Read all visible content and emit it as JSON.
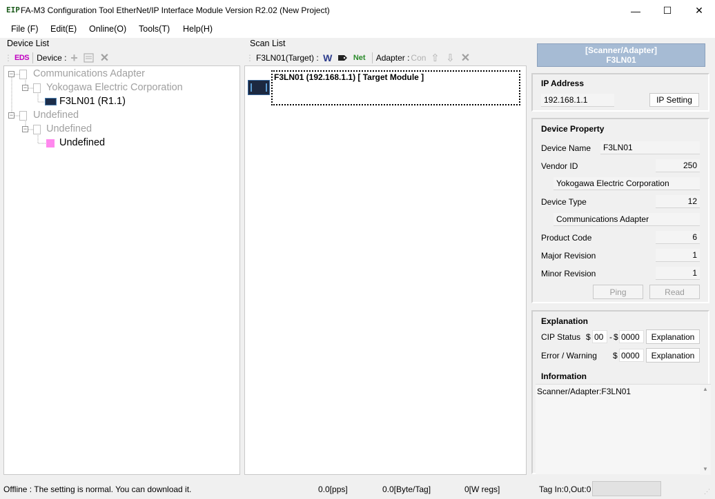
{
  "window": {
    "title": "FA-M3 Configuration Tool EtherNet/IP Interface Module Version R2.02 (New Project)",
    "app_icon": "EIP",
    "controls": {
      "minimize": "—",
      "maximize": "☐",
      "close": "✕"
    }
  },
  "menu": [
    "File (F)",
    "Edit(E)",
    "Online(O)",
    "Tools(T)",
    "Help(H)"
  ],
  "device_list": {
    "label": "Device List",
    "toolbar": {
      "eds": "EDS",
      "device_label": "Device :"
    },
    "tree": [
      {
        "label": "Communications Adapter"
      },
      {
        "label": "Yokogawa Electric Corporation"
      },
      {
        "label": "F3LN01  (R1.1)"
      },
      {
        "label": "Undefined"
      },
      {
        "label": "Undefined"
      },
      {
        "label": "Undefined"
      }
    ]
  },
  "scan_list": {
    "label": "Scan List",
    "toolbar": {
      "target_label": "F3LN01(Target) :",
      "adapter_label": "Adapter :",
      "con_label": "Con",
      "w_icon": "W",
      "net_icon": "Net"
    },
    "item": "F3LN01 (192.168.1.1)  [ Target Module ]"
  },
  "right_panel": {
    "header_line1": "[Scanner/Adapter]",
    "header_line2": "F3LN01",
    "ip": {
      "title": "IP Address",
      "value": "192.168.1.1",
      "button": "IP Setting"
    },
    "device_property": {
      "title": "Device Property",
      "device_name_label": "Device Name",
      "device_name": "F3LN01",
      "vendor_id_label": "Vendor ID",
      "vendor_id": "250",
      "vendor_name": "Yokogawa Electric Corporation",
      "device_type_label": "Device Type",
      "device_type": "12",
      "device_type_name": "Communications Adapter",
      "product_code_label": "Product Code",
      "product_code": "6",
      "major_revision_label": "Major Revision",
      "major_revision": "1",
      "minor_revision_label": "Minor Revision",
      "minor_revision": "1",
      "ping_button": "Ping",
      "read_button": "Read"
    },
    "explanation": {
      "title": "Explanation",
      "cip_status_label": "CIP Status",
      "dollar": "$",
      "dash": "-",
      "cip_status_1": "00",
      "cip_status_2": "0000",
      "error_label": "Error / Warning",
      "error_value": "0000",
      "explanation_button": "Explanation"
    },
    "information": {
      "title": "Information",
      "text": "Scanner/Adapter:F3LN01"
    }
  },
  "status_bar": {
    "message": "Offline : The setting is normal. You can download it.",
    "pps": "0.0[pps]",
    "byte_tag": "0.0[Byte/Tag]",
    "w_regs": "0[W regs]",
    "tag_io": "Tag In:0,Out:0"
  }
}
